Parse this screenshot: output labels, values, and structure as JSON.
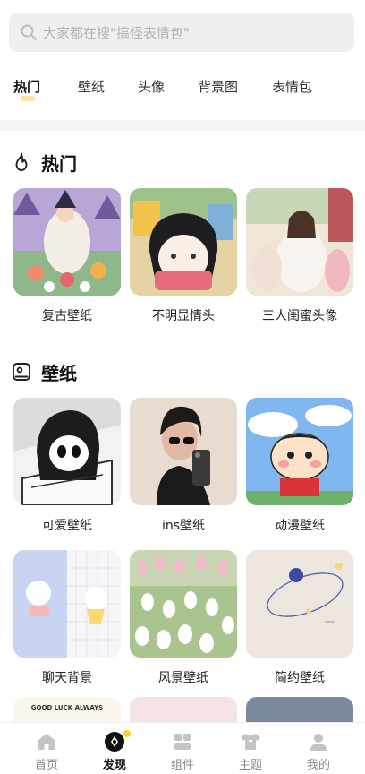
{
  "search": {
    "placeholder": "大家都在搜\"搞怪表情包\""
  },
  "tabs": [
    {
      "label": "热门",
      "active": true
    },
    {
      "label": "壁纸"
    },
    {
      "label": "头像"
    },
    {
      "label": "背景图"
    },
    {
      "label": "表情包"
    }
  ],
  "sections": {
    "hot": {
      "title": "热门",
      "items": [
        {
          "label": "复古壁纸"
        },
        {
          "label": "不明显情头"
        },
        {
          "label": "三人闺蜜头像"
        }
      ]
    },
    "wallpaper": {
      "title": "壁纸",
      "items": [
        {
          "label": "可爱壁纸"
        },
        {
          "label": "ins壁纸"
        },
        {
          "label": "动漫壁纸"
        },
        {
          "label": "聊天背景"
        },
        {
          "label": "风景壁纸"
        },
        {
          "label": "简约壁纸"
        }
      ]
    }
  },
  "partial_card_text": "GOOD LUCK ALWAYS",
  "bottom_nav": [
    {
      "label": "首页",
      "icon": "home-icon"
    },
    {
      "label": "发现",
      "icon": "discover-icon",
      "active": true
    },
    {
      "label": "组件",
      "icon": "widgets-icon"
    },
    {
      "label": "主题",
      "icon": "theme-shirt-icon"
    },
    {
      "label": "我的",
      "icon": "profile-icon"
    }
  ],
  "colors": {
    "accent": "#ffcc33",
    "tab_underline": "#ffe2a1"
  }
}
